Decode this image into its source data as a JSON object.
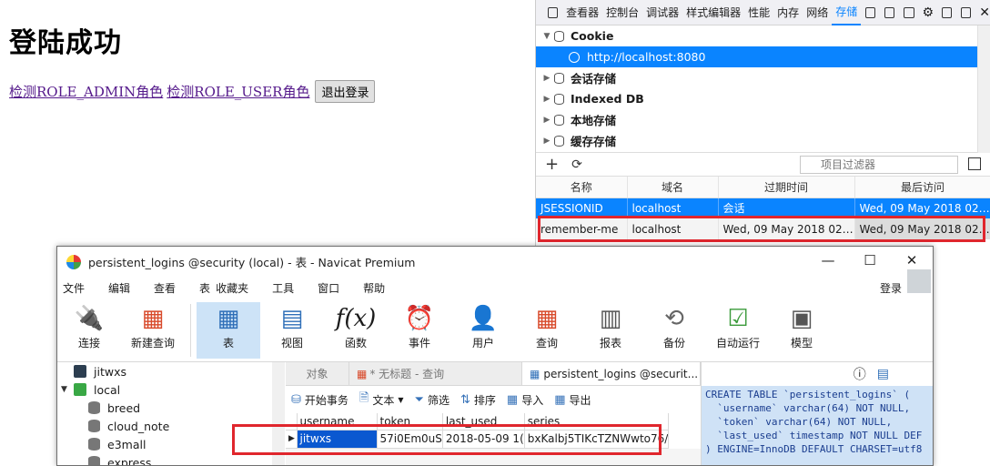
{
  "webpage": {
    "title": "登陆成功",
    "link_admin": "检测ROLE_ADMIN角色",
    "link_user": "检测ROLE_USER角色",
    "logout_button": "退出登录"
  },
  "devtools": {
    "tabs": [
      "查看器",
      "控制台",
      "调试器",
      "样式编辑器",
      "性能",
      "内存",
      "网络",
      "存储"
    ],
    "tree": {
      "cookie": "Cookie",
      "cookie_host": "http://localhost:8080",
      "session_storage": "会话存储",
      "indexed_db": "Indexed DB",
      "local_storage": "本地存储",
      "cache_storage": "缓存存储"
    },
    "filter_placeholder": "项目过滤器",
    "columns": {
      "name": "名称",
      "domain": "域名",
      "expires": "过期时间",
      "last_access": "最后访问"
    },
    "cookies": [
      {
        "name": "JSESSIONID",
        "domain": "localhost",
        "expires": "会话",
        "last_access": "Wed, 09 May 2018 02:..."
      },
      {
        "name": "remember-me",
        "domain": "localhost",
        "expires": "Wed, 09 May 2018 02:...",
        "last_access": "Wed, 09 May 2018 02:..."
      }
    ]
  },
  "navicat": {
    "title": "persistent_logins @security (local) - 表 - Navicat Premium",
    "menu": [
      "文件",
      "编辑",
      "查看",
      "表",
      "收藏夹",
      "工具",
      "窗口",
      "帮助"
    ],
    "login": "登录",
    "toolbar": [
      "连接",
      "新建查询",
      "表",
      "视图",
      "函数",
      "事件",
      "用户",
      "查询",
      "报表",
      "备份",
      "自动运行",
      "模型"
    ],
    "sidebar": {
      "conn1": "jitwxs",
      "conn2": "local",
      "dbs": [
        "breed",
        "cloud_note",
        "e3mall",
        "express"
      ]
    },
    "tabs": {
      "objects": "对象",
      "untitled": "* 无标题 - 查询",
      "table": "persistent_logins @securit..."
    },
    "actions": {
      "begin": "开始事务",
      "text": "文本",
      "filter": "筛选",
      "sort": "排序",
      "import": "导入",
      "export": "导出"
    },
    "grid": {
      "columns": [
        "username",
        "token",
        "last_used",
        "series"
      ],
      "row": {
        "username": "jitwxs",
        "token": "57i0Em0uS",
        "last_used": "2018-05-09 1(",
        "series": "bxKalbj5TIKcTZNWwto76/"
      }
    },
    "ddl_lines": [
      "CREATE TABLE `persistent_logins` (",
      "  `username` varchar(64) NOT NULL,",
      "  `token` varchar(64) NOT NULL,",
      "  `last_used` timestamp NOT NULL DEF",
      ") ENGINE=InnoDB DEFAULT CHARSET=utf8"
    ]
  },
  "colors": {
    "accent": "#0a84ff",
    "highlight": "#e0262d",
    "link": "#551a8b"
  }
}
